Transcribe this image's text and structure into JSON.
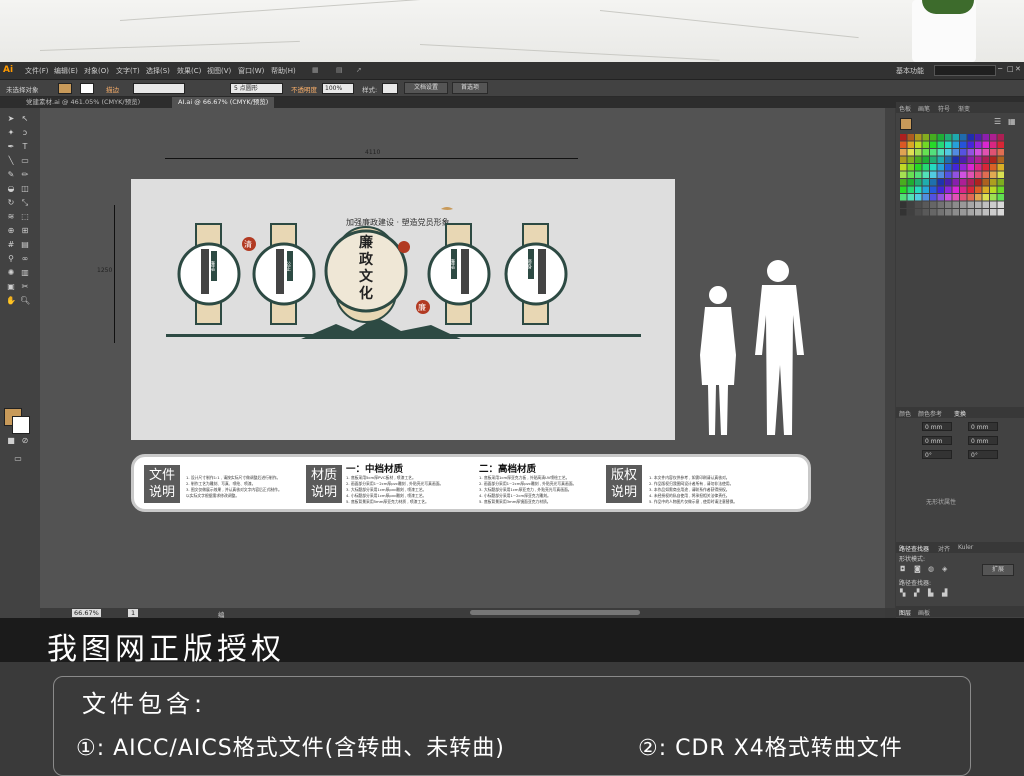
{
  "menubar": {
    "logo": "Ai",
    "items": [
      "文件(F)",
      "编辑(E)",
      "对象(O)",
      "文字(T)",
      "选择(S)",
      "效果(C)",
      "视图(V)",
      "窗口(W)",
      "帮助(H)"
    ],
    "workspace": "基本功能"
  },
  "control_bar": {
    "selection": "未选择对象",
    "stroke_label": "描边",
    "brush": "5 点圆形",
    "opacity_label": "不透明度",
    "opacity_value": "100%",
    "style_label": "样式:",
    "doc_setup": "文档设置",
    "preferences": "首选项"
  },
  "tabs": [
    {
      "label": "党建素材.ai @ 461.05% (CMYK/预览)",
      "active": false
    },
    {
      "label": "AI.ai @ 66.67% (CMYK/预览)",
      "active": true
    }
  ],
  "canvas": {
    "dim_width": "4110",
    "dim_height": "1250",
    "design": {
      "header": "加强廉政建设 · 塑造党员形象",
      "center_title": "廉\n政\n文\n化",
      "seal_top": "清",
      "seal_bottom": "廉",
      "panel_labels": [
        "廉洁",
        "公正",
        "廉洁",
        "修身"
      ]
    }
  },
  "info_bar": {
    "sections": [
      {
        "label": "文件\n说明",
        "lines": [
          "1. 设计尺寸制作1:1 , 请按实际尺寸做调整后进行制作。",
          "2. 制作工艺为雕刻、写真、喷绘、喷漆。",
          "3. 图文仅做展示效果 , 并认真核对文字内容后正式制作。",
          "   以实际文字根据需求修改调整。"
        ]
      },
      {
        "label": "材质\n说明",
        "head": "一：中档材质",
        "lines": [
          "1. 底板采用5cm厚PVC板材 , 喷漆工艺。",
          "2. 画面部分采用1~2cm厚pvc雕刻 , 外贴亮光写真画面。",
          "3. 大标题部分采用1cm厚pvc雕刻 , 喷漆工艺。",
          "4. 小标题部分采用1cm厚pvc雕刻 , 喷漆工艺。",
          "5. 底板背景采用5mm厚亚克力材质 , 喷漆工艺。"
        ]
      },
      {
        "head": "二：高档材质",
        "lines": [
          "1. 底板采用1cm厚亚克力板 , 外贴高清UV喷绘工艺。",
          "2. 画面部分采用1~2cm厚pvc雕刻 , 外贴亮光写真画面。",
          "3. 大标题部分采用1cm厚亚克力 , 外贴亮光写真画面。",
          "4. 小标题部分采用1~2cm厚亚克力雕刻。",
          "5. 底板背景采用3mm厚镜面亚克力材质。"
        ]
      },
      {
        "label": "版权\n说明",
        "lines": [
          "1. 本文件内容仅供参考 , 如需印刷请认真核对。",
          "2. 作品版权归我图网设计者所有 , 请勿非法使用。",
          "3. 本作品如需商业用途 , 请联系作者获得授权。",
          "4. 未经授权的私自使用 , 将承担相关法律责任。",
          "5. 作品中的人物图片仅做示意 , 使用时请注意替换。"
        ]
      }
    ]
  },
  "status": {
    "zoom": "66.67%",
    "page": "1",
    "tool": "编组选择"
  },
  "right_panel": {
    "tabs": [
      "色板",
      "画笔",
      "符号",
      "渐变"
    ],
    "transform_tabs": [
      "颜色",
      "颜色参考",
      "变换"
    ],
    "fields": [
      "0 mm",
      "0 mm",
      "0 mm",
      "0 mm",
      "0°",
      "0°"
    ],
    "no_state": "无形状属性",
    "pathfinder_tabs": [
      "路径查找器",
      "对齐",
      "Kuler"
    ],
    "shape_mode": "形状模式:",
    "expand": "扩展",
    "pathfinders": "路径查找器:",
    "layer_tabs": [
      "图层",
      "画板"
    ]
  },
  "banner": {
    "title": "我图网正版授权",
    "file_box_title": "文件包含:",
    "item1": "①: AICC/AICS格式文件(含转曲、未转曲)",
    "item2": "②: CDR X4格式转曲文件"
  }
}
